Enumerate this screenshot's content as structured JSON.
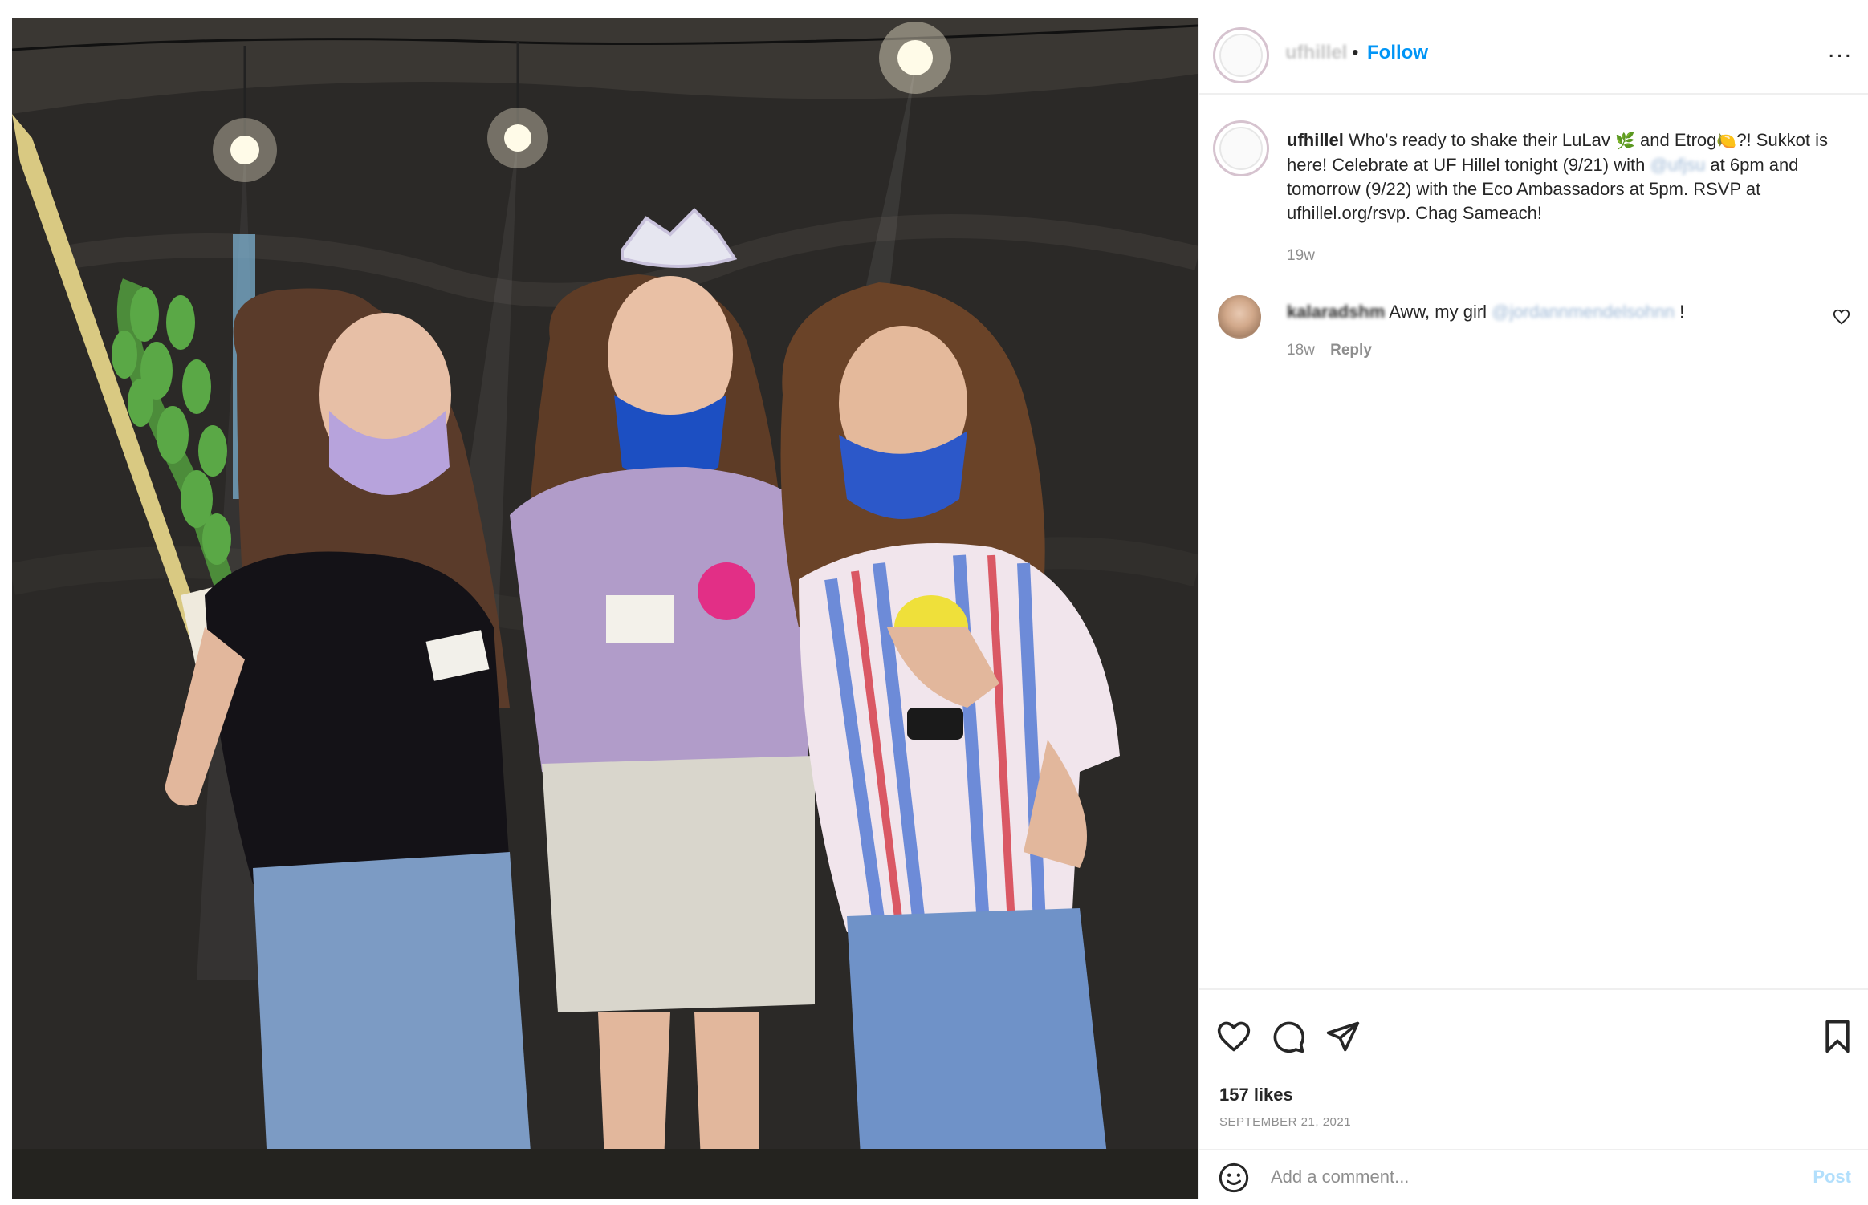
{
  "post": {
    "photo_alt": "",
    "username": "ufhillel",
    "dot": "•",
    "follow_label": "Follow",
    "more_label": "...",
    "more_icon": "more-horizontal-icon"
  },
  "caption": {
    "username": "ufhillel",
    "text_1": "Who's ready to shake their LuLav",
    "emoji_1": "🌿",
    "text_2": "and Etrog",
    "emoji_2": "🍋",
    "text_3": "?! Sukkot is here! Celebrate at UF Hillel tonight (9/21) with",
    "mention": "@ufjsu",
    "text_4": "at 6pm and tomorrow (9/22) with the Eco Ambassadors at 5pm. RSVP at ufhillel.org/rsvp. Chag Sameach!",
    "time": "19w"
  },
  "comment": {
    "username": "kalaradshm",
    "text": "Aww, my girl",
    "mention": "@jordannmendelsohnn",
    "suffix": "!",
    "time": "18w",
    "reply_label": "Reply"
  },
  "actions": {
    "likes": "157 likes",
    "date": "SEPTEMBER 21, 2021"
  },
  "add_comment": {
    "placeholder": "Add a comment...",
    "post_label": "Post"
  },
  "colors": {
    "link": "#0095f6",
    "post_disabled": "#b2dffc",
    "muted": "#8e8e8e",
    "text": "#262626"
  }
}
